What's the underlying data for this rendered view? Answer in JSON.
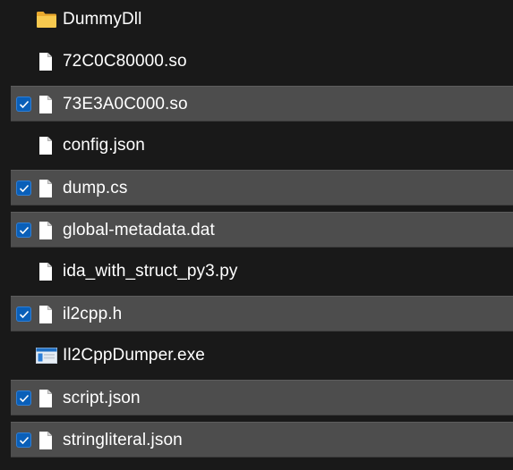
{
  "files": [
    {
      "name": "DummyDll",
      "type": "folder",
      "selected": false
    },
    {
      "name": "72C0C80000.so",
      "type": "file",
      "selected": false
    },
    {
      "name": "73E3A0C000.so",
      "type": "file",
      "selected": true
    },
    {
      "name": "config.json",
      "type": "file",
      "selected": false
    },
    {
      "name": "dump.cs",
      "type": "file",
      "selected": true
    },
    {
      "name": "global-metadata.dat",
      "type": "file",
      "selected": true
    },
    {
      "name": "ida_with_struct_py3.py",
      "type": "file",
      "selected": false
    },
    {
      "name": "il2cpp.h",
      "type": "file",
      "selected": true
    },
    {
      "name": "Il2CppDumper.exe",
      "type": "exe",
      "selected": false
    },
    {
      "name": "script.json",
      "type": "file",
      "selected": true
    },
    {
      "name": "stringliteral.json",
      "type": "file",
      "selected": true
    }
  ],
  "icons": {
    "folder": "folder-icon",
    "file": "document-icon",
    "exe": "application-icon"
  },
  "colors": {
    "background": "#191919",
    "selected_row": "#4d4d4d",
    "checkbox": "#0a5fb8",
    "folder": "#f5c04a",
    "document": "#ffffff"
  }
}
